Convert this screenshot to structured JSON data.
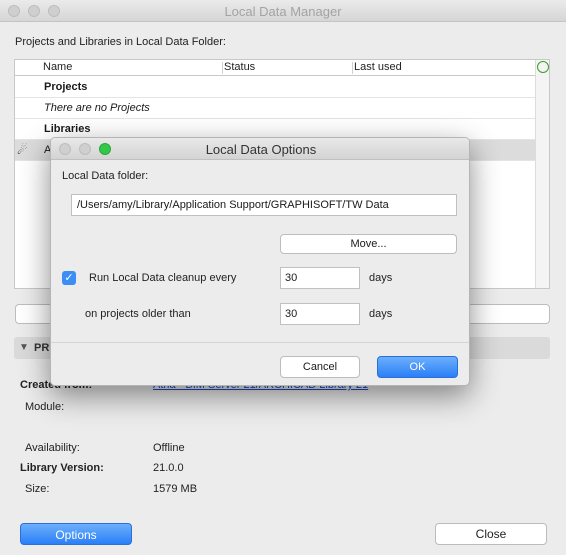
{
  "window": {
    "title": "Local Data Manager"
  },
  "main": {
    "section_label": "Projects and Libraries in Local Data Folder:",
    "table": {
      "columns": [
        "Name",
        "Status",
        "Last used"
      ],
      "rows": [
        {
          "type": "group",
          "label": "Projects"
        },
        {
          "type": "empty",
          "label": "There are no Projects"
        },
        {
          "type": "group",
          "label": "Libraries"
        },
        {
          "type": "item",
          "label": "A",
          "icon": "library-icon"
        }
      ]
    },
    "properties_header": "PR",
    "info": {
      "created_from_label": "Created from:",
      "created_from_value": "Atria - BIM Server 21/ARCHICAD Library 21",
      "module_label": "Module:",
      "availability_label": "Availability:",
      "availability_value": "Offline",
      "library_version_label": "Library Version:",
      "library_version_value": "21.0.0",
      "size_label": "Size:",
      "size_value": "1579 MB"
    },
    "options_button": "Options",
    "close_button": "Close"
  },
  "dialog": {
    "title": "Local Data Options",
    "folder_label": "Local Data folder:",
    "folder_path": "/Users/amy/Library/Application Support/GRAPHISOFT/TW Data",
    "move_button": "Move...",
    "cleanup_checked": true,
    "cleanup_label": "Run Local Data cleanup every",
    "cleanup_value": "30",
    "cleanup_unit": "days",
    "older_label": "on projects older than",
    "older_value": "30",
    "older_unit": "days",
    "cancel_button": "Cancel",
    "ok_button": "OK"
  },
  "colors": {
    "accent_blue": "#2a7ff7",
    "link_blue": "#1f4bd1",
    "close_light": "#fc605c",
    "minimize_light": "#fdbc40",
    "zoom_light": "#34c84a"
  }
}
